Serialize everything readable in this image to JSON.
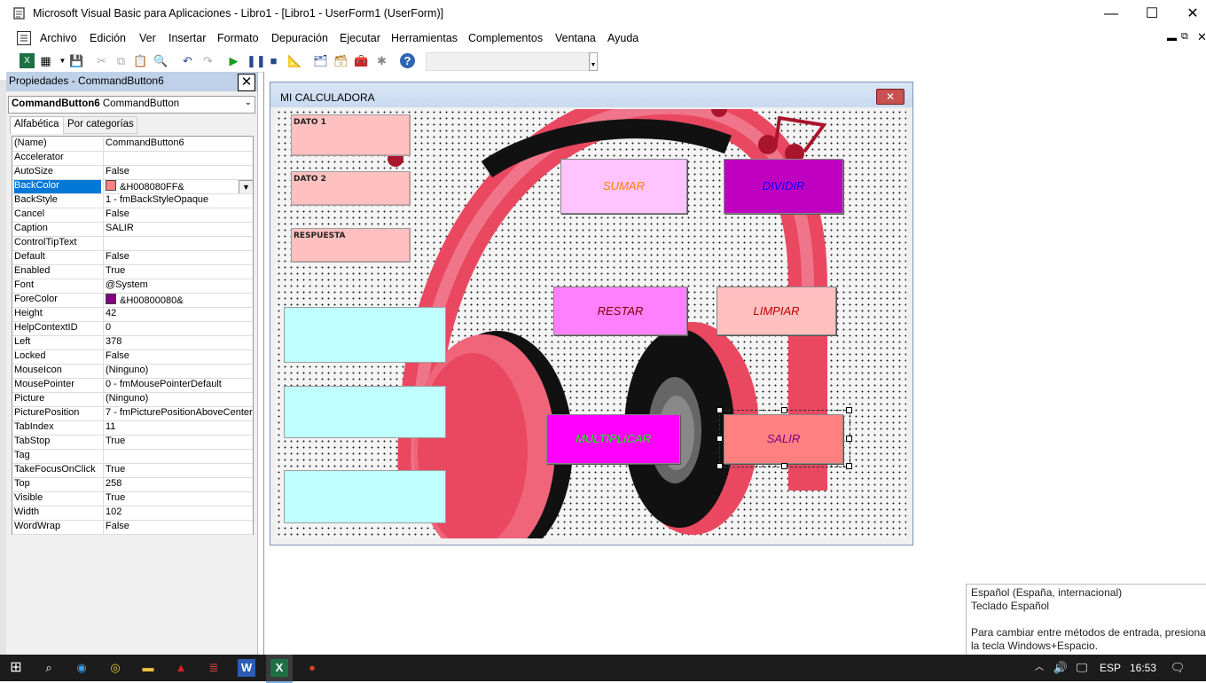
{
  "window": {
    "title": "Microsoft Visual Basic para Aplicaciones - Libro1 - [Libro1 - UserForm1 (UserForm)]",
    "minimize": "—",
    "maximize": "☐",
    "close": "✕"
  },
  "menu": {
    "items": [
      {
        "label": "Archivo"
      },
      {
        "label": "Edición"
      },
      {
        "label": "Ver"
      },
      {
        "label": "Insertar"
      },
      {
        "label": "Formato"
      },
      {
        "label": "Depuración"
      },
      {
        "label": "Ejecutar"
      },
      {
        "label": "Herramientas"
      },
      {
        "label": "Complementos"
      },
      {
        "label": "Ventana"
      },
      {
        "label": "Ayuda"
      }
    ]
  },
  "properties": {
    "title": "Propiedades - CommandButton6",
    "object_name": "CommandButton6",
    "object_type": "CommandButton",
    "tab_alpha": "Alfabética",
    "tab_category": "Por categorías",
    "rows": [
      {
        "key": "(Name)",
        "value": "CommandButton6"
      },
      {
        "key": "Accelerator",
        "value": ""
      },
      {
        "key": "AutoSize",
        "value": "False"
      },
      {
        "key": "BackColor",
        "value": "&H008080FF&"
      },
      {
        "key": "BackStyle",
        "value": "1 - fmBackStyleOpaque"
      },
      {
        "key": "Cancel",
        "value": "False"
      },
      {
        "key": "Caption",
        "value": "SALIR"
      },
      {
        "key": "ControlTipText",
        "value": ""
      },
      {
        "key": "Default",
        "value": "False"
      },
      {
        "key": "Enabled",
        "value": "True"
      },
      {
        "key": "Font",
        "value": "@System"
      },
      {
        "key": "ForeColor",
        "value": "&H00800080&"
      },
      {
        "key": "Height",
        "value": "42"
      },
      {
        "key": "HelpContextID",
        "value": "0"
      },
      {
        "key": "Left",
        "value": "378"
      },
      {
        "key": "Locked",
        "value": "False"
      },
      {
        "key": "MouseIcon",
        "value": "(Ninguno)"
      },
      {
        "key": "MousePointer",
        "value": "0 - fmMousePointerDefault"
      },
      {
        "key": "Picture",
        "value": "(Ninguno)"
      },
      {
        "key": "PicturePosition",
        "value": "7 - fmPicturePositionAboveCenter"
      },
      {
        "key": "TabIndex",
        "value": "11"
      },
      {
        "key": "TabStop",
        "value": "True"
      },
      {
        "key": "Tag",
        "value": ""
      },
      {
        "key": "TakeFocusOnClick",
        "value": "True"
      },
      {
        "key": "Top",
        "value": "258"
      },
      {
        "key": "Visible",
        "value": "True"
      },
      {
        "key": "Width",
        "value": "102"
      },
      {
        "key": "WordWrap",
        "value": "False"
      }
    ],
    "backcolor_swatch": "#ff8080",
    "forecolor_swatch": "#800080"
  },
  "userform": {
    "caption": "MI CALCULADORA",
    "close": "✕",
    "labels": {
      "dato1": "DATO 1",
      "dato2": "DATO 2",
      "respuesta": "RESPUESTA"
    },
    "buttons": {
      "sumar": "SUMAR",
      "dividir": "DIVIDIR",
      "restar": "RESTAR",
      "limpiar": "LIMPIAR",
      "multiplicar": "MULTIPLICAR",
      "salir": "SALIR"
    }
  },
  "tooltip": {
    "line1": "Español (España, internacional)",
    "line2": "Teclado Español",
    "line3": "Para cambiar entre métodos de entrada, presiona",
    "line4": "la tecla Windows+Espacio."
  },
  "taskbar": {
    "language": "ESP",
    "time": "16:53"
  }
}
